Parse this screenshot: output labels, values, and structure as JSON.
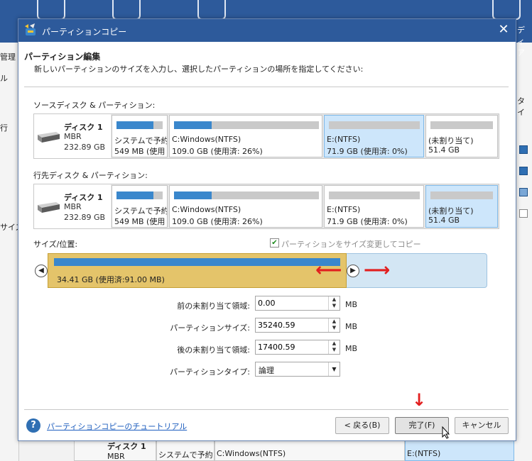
{
  "background": {
    "left_labels": [
      "管理",
      "ル",
      "行",
      "サイズ"
    ],
    "right_labels": [
      "ディア",
      "タイ"
    ],
    "bottom_disk": {
      "name": "ディスク 1",
      "type": "MBR",
      "part1": "システムで予約",
      "part2": "C:Windows(NTFS)",
      "part3": "E:(NTFS)"
    }
  },
  "dialog": {
    "title": "パーティションコピー",
    "close_glyph": "✕",
    "heading": "パーティション編集",
    "subheading": "新しいパーティションのサイズを入力し、選択したパーティションの場所を指定してください:",
    "source_label": "ソースディスク & パーティション:",
    "dest_label": "行先ディスク & パーティション:",
    "source_disk": {
      "name": "ディスク 1",
      "type": "MBR",
      "size": "232.89 GB",
      "partitions": [
        {
          "name": "システムで予約",
          "info": "549 MB (使用",
          "usage": 0.8
        },
        {
          "name": "C:Windows(NTFS)",
          "info": "109.0 GB (使用済: 26%)",
          "usage": 0.26
        },
        {
          "name": "E:(NTFS)",
          "info": "71.9 GB (使用済: 0%)",
          "usage": 0.0
        },
        {
          "name": "(未割り当て)",
          "info": "51.4 GB",
          "usage": 0.0
        }
      ]
    },
    "dest_disk": {
      "name": "ディスク 1",
      "type": "MBR",
      "size": "232.89 GB",
      "partitions": [
        {
          "name": "システムで予約",
          "info": "549 MB (使用",
          "usage": 0.8
        },
        {
          "name": "C:Windows(NTFS)",
          "info": "109.0 GB (使用済: 26%)",
          "usage": 0.26
        },
        {
          "name": "E:(NTFS)",
          "info": "71.9 GB (使用済: 0%)",
          "usage": 0.0
        },
        {
          "name": "(未割り当て)",
          "info": "51.4 GB",
          "usage": 0.0
        }
      ]
    },
    "size_position_label": "サイズ/位置:",
    "resize_checkbox_label": "パーティションをサイズ変更してコピー",
    "resize_checked": true,
    "slider_text": "34.41 GB (使用済:91.00 MB)",
    "fields": {
      "before_label": "前の未割り当て領域:",
      "before_value": "0.00",
      "size_label": "パーティションサイズ:",
      "size_value": "35240.59",
      "after_label": "後の未割り当て領域:",
      "after_value": "17400.59",
      "unit": "MB",
      "type_label": "パーティションタイプ:",
      "type_value": "論理"
    },
    "help_link": "パーティションコピーのチュートリアル",
    "buttons": {
      "back": "< 戻る(B)",
      "finish": "完了(F)",
      "cancel": "キャンセル"
    },
    "colors": {
      "titlebar": "#2d5a9b",
      "selected_partition": "#cde6fb",
      "usage_bar": "#3a87cc",
      "resize_block": "#e4c46a",
      "annotation_arrow": "#e21f1f"
    }
  }
}
